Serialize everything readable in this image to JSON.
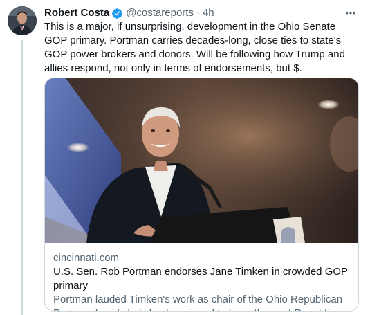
{
  "tweet": {
    "author_name": "Robert Costa",
    "handle": "@costareports",
    "separator": "·",
    "timestamp": "4h",
    "verified": true,
    "text": "This is a major, if unsurprising, development in the Ohio Senate GOP primary. Portman carries decades-long, close ties to state's GOP power brokers and donors. Will be following how Trump and allies respond, not only in terms of endorsements, but $."
  },
  "card": {
    "domain": "cincinnati.com",
    "title": "U.S. Sen. Rob Portman endorses Jane Timken in crowded GOP primary",
    "description": "Portman lauded Timken's work as chair of the Ohio Republican Party and said she's best equipped to keep the seat Republican."
  },
  "icons": {
    "verified": "verified-badge-icon",
    "more": "more-options-icon"
  },
  "colors": {
    "verified_blue": "#1d9bf0",
    "secondary_text": "#536471",
    "primary_text": "#0f1419",
    "border": "#cfd9de"
  }
}
